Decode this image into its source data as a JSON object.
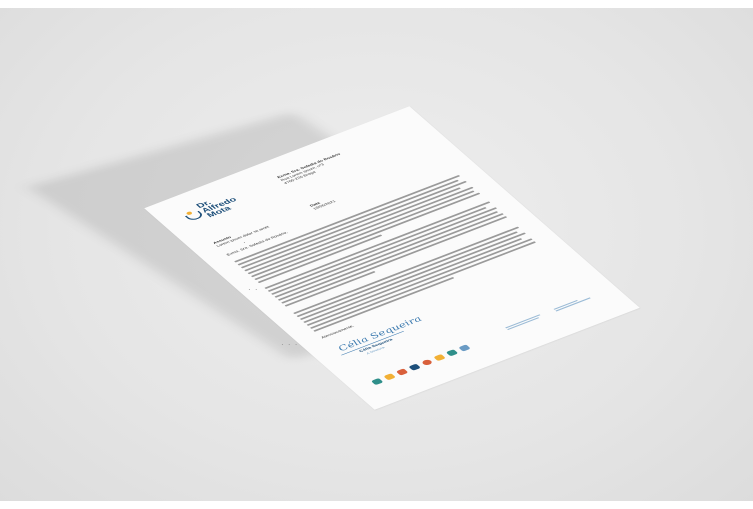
{
  "letter": {
    "logo_line1": "Dr.",
    "logo_line2": "Alfredo",
    "logo_line3": "Mota",
    "recipient_line1": "Exma. Sra. Sofedia do Rosário",
    "recipient_line2": "Rua Lorem ipsum, nº3",
    "recipient_line3": "4700-220 Braga",
    "subject_label": "Assunto",
    "subject_value": "Lorem ipsum dolor sit amet",
    "date_label": "Data",
    "date_value": "18/06/2021",
    "salutation": "Exma. Sra. Sofedia do Rosário,",
    "closing": "Atenciosamente,",
    "signature_script": "Célia Sequeira",
    "signer_name": "Célia Sequeira",
    "signer_role": "A Diretora"
  },
  "colors": {
    "brand_blue": "#1d4f7a",
    "accent_yellow": "#f2b035",
    "light_blue": "#6a9bc4",
    "accent_red": "#d9603b",
    "accent_teal": "#2f8f8a"
  }
}
